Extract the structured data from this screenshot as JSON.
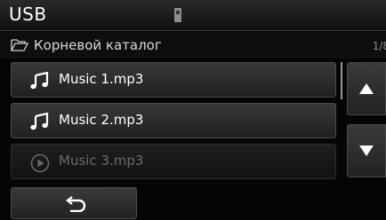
{
  "header": {
    "title": "USB",
    "source_icon": "usb-drive-icon"
  },
  "path": {
    "folder_icon": "folder-open-icon",
    "label": "Корневой каталог",
    "page": "1/8"
  },
  "tracks": [
    {
      "name": "Music 1.mp3",
      "icon": "music-note-icon",
      "state": "normal"
    },
    {
      "name": "Music 2.mp3",
      "icon": "music-note-icon",
      "state": "normal"
    },
    {
      "name": "Music 3.mp3",
      "icon": "play-circle-icon",
      "state": "dimmed"
    }
  ],
  "controls": {
    "scroll_up_icon": "triangle-up-icon",
    "scroll_down_icon": "triangle-down-icon",
    "back_icon": "back-arrow-icon"
  }
}
